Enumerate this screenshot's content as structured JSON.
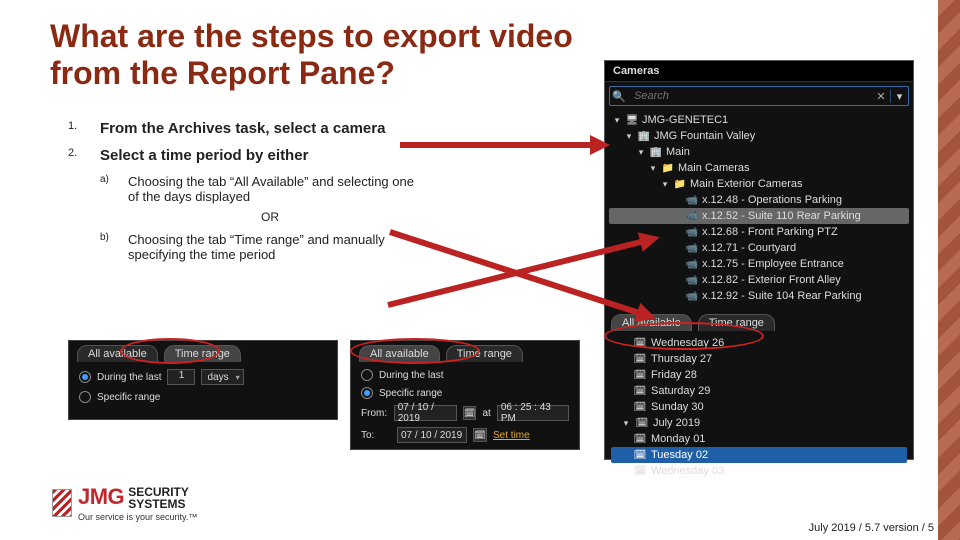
{
  "title": "What are the steps to export video from the Report Pane?",
  "list": {
    "item1_num": "1.",
    "item1": "From the Archives task, select a camera",
    "item2_num": "2.",
    "item2": "Select a time period by either",
    "sub_a_letter": "a)",
    "sub_a": "Choosing the tab “All Available” and selecting one of the days displayed",
    "or": "OR",
    "sub_b_letter": "b)",
    "sub_b": "Choosing the tab “Time range” and manually specifying the time period"
  },
  "panel": {
    "header": "Cameras",
    "search_placeholder": "Search",
    "tree": [
      {
        "indent": 0,
        "twisty": "▾",
        "icon": "server-ic",
        "label": "JMG-GENETEC1",
        "sel": false
      },
      {
        "indent": 1,
        "twisty": "▾",
        "icon": "site-ic",
        "label": "JMG Fountain Valley",
        "sel": false
      },
      {
        "indent": 2,
        "twisty": "▾",
        "icon": "site-ic",
        "label": "Main",
        "sel": false
      },
      {
        "indent": 3,
        "twisty": "▾",
        "icon": "folder-ic",
        "label": "Main Cameras",
        "sel": false
      },
      {
        "indent": 4,
        "twisty": "▾",
        "icon": "folder-ic",
        "label": "Main Exterior Cameras",
        "sel": false
      },
      {
        "indent": 5,
        "twisty": "",
        "icon": "camera-ic",
        "label": "x.12.48 - Operations Parking",
        "sel": false
      },
      {
        "indent": 5,
        "twisty": "",
        "icon": "camera-ic",
        "label": "x.12.52 - Suite 110 Rear Parking",
        "sel": true
      },
      {
        "indent": 5,
        "twisty": "",
        "icon": "camera-ic",
        "label": "x.12.68 - Front Parking PTZ",
        "sel": false
      },
      {
        "indent": 5,
        "twisty": "",
        "icon": "camera-ic",
        "label": "x.12.71 - Courtyard",
        "sel": false
      },
      {
        "indent": 5,
        "twisty": "",
        "icon": "camera-ic",
        "label": "x.12.75 - Employee Entrance",
        "sel": false
      },
      {
        "indent": 5,
        "twisty": "",
        "icon": "camera-ic",
        "label": "x.12.82 - Exterior Front Alley",
        "sel": false
      },
      {
        "indent": 5,
        "twisty": "",
        "icon": "camera-ic",
        "label": "x.12.92 - Suite 104 Rear Parking",
        "sel": false
      }
    ],
    "tabs": {
      "all": "All available",
      "range": "Time range"
    },
    "days": [
      {
        "label": "Wednesday 26",
        "sel": false
      },
      {
        "label": "Thursday 27",
        "sel": false
      },
      {
        "label": "Friday 28",
        "sel": false
      },
      {
        "label": "Saturday 29",
        "sel": false
      },
      {
        "label": "Sunday 30",
        "sel": false
      }
    ],
    "month_row": {
      "twisty": "▾",
      "label": "July 2019"
    },
    "days2": [
      {
        "label": "Monday 01",
        "sel": false
      },
      {
        "label": "Tuesday 02",
        "sel": true
      },
      {
        "label": "Wednesday 03",
        "sel": false
      }
    ]
  },
  "shot1": {
    "tabs": {
      "all": "All available",
      "range": "Time range"
    },
    "radio1": "During the last",
    "num": "1",
    "unit": "days",
    "radio2": "Specific range"
  },
  "shot2": {
    "tabs": {
      "all": "All available",
      "range": "Time range"
    },
    "radio1": "During the last",
    "radio2": "Specific range",
    "from_lbl": "From:",
    "from_date": "07 / 10 / 2019",
    "at_lbl": "at",
    "from_time": "06 : 25 : 43 PM",
    "to_lbl": "To:",
    "to_date": "07 / 10 / 2019",
    "set_time": "Set time"
  },
  "logo": {
    "jmg": "JMG",
    "line1": "SECURITY",
    "line2": "SYSTEMS",
    "tag": "Our service is your security.™"
  },
  "footer": "July 2019 / 5.7 version / 5"
}
